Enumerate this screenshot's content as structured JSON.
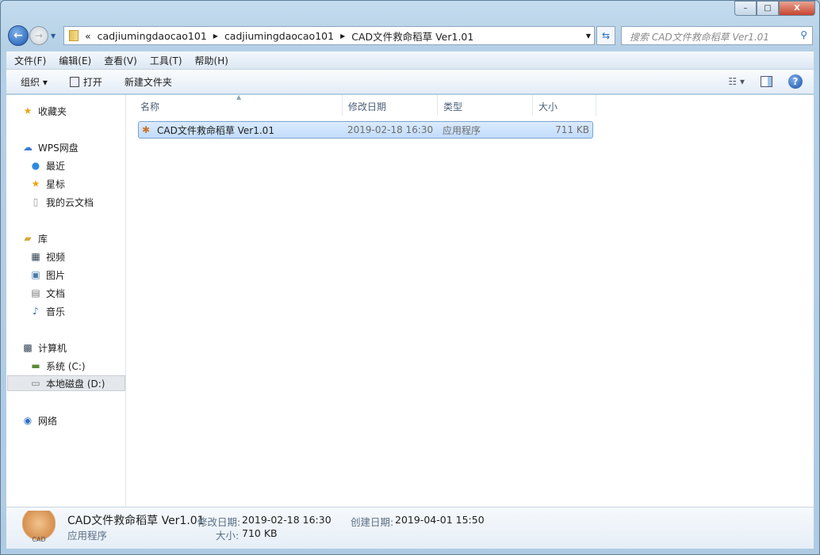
{
  "window": {
    "minimize": "–",
    "maximize": "□",
    "close": "X"
  },
  "address": {
    "overflow": "«",
    "crumbs": [
      "cadjiumingdaocao101",
      "cadjiumingdaocao101",
      "CAD文件救命稻草 Ver1.01"
    ]
  },
  "search": {
    "placeholder": "搜索 CAD文件救命稻草 Ver1.01"
  },
  "menu": [
    "文件(F)",
    "编辑(E)",
    "查看(V)",
    "工具(T)",
    "帮助(H)"
  ],
  "toolbar": {
    "organize": "组织 ▾",
    "open": "打开",
    "new_folder": "新建文件夹"
  },
  "sidebar": {
    "favorites": "收藏夹",
    "wps": "WPS网盘",
    "recent": "最近",
    "starred": "星标",
    "cloud_docs": "我的云文档",
    "libraries": "库",
    "videos": "视频",
    "pictures": "图片",
    "documents": "文档",
    "music": "音乐",
    "computer": "计算机",
    "drive_c": "系统 (C:)",
    "drive_d": "本地磁盘 (D:)",
    "network": "网络"
  },
  "columns": [
    "名称",
    "修改日期",
    "类型",
    "大小"
  ],
  "files": [
    {
      "name": "CAD文件救命稻草 Ver1.01",
      "modified": "2019-02-18 16:30",
      "type": "应用程序",
      "size": "711 KB"
    }
  ],
  "details": {
    "name": "CAD文件救命稻草 Ver1.01",
    "type": "应用程序",
    "modified_label": "修改日期:",
    "modified": "2019-02-18 16:30",
    "created_label": "创建日期:",
    "created": "2019-04-01 15:50",
    "size_label": "大小:",
    "size": "710 KB",
    "icon_text": "CAD"
  }
}
